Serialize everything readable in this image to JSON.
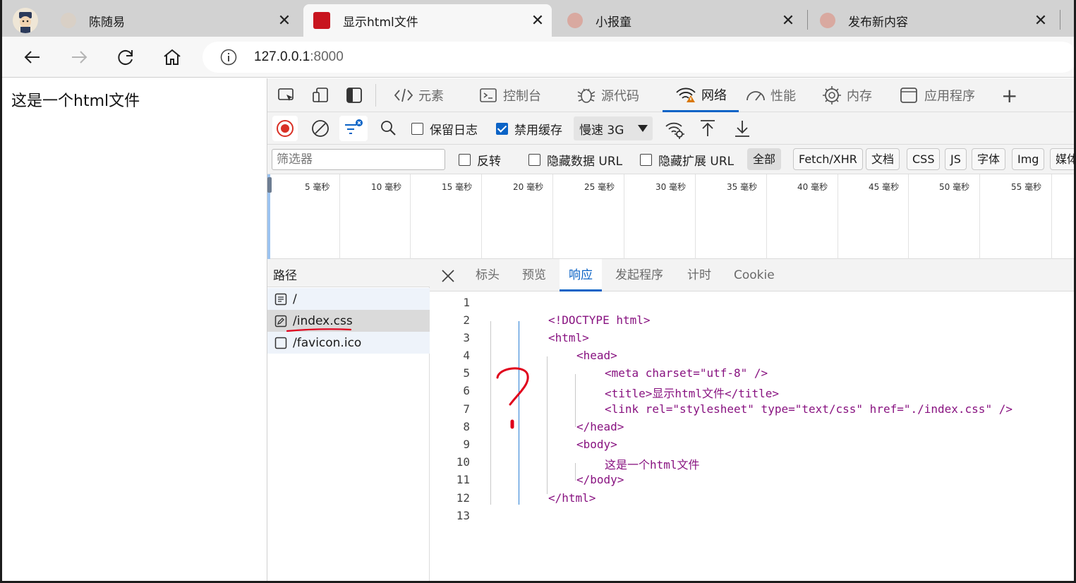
{
  "browser": {
    "tabs": [
      {
        "title": "陈随易",
        "active": false
      },
      {
        "title": "显示html文件",
        "active": true
      },
      {
        "title": "小报童",
        "active": false
      },
      {
        "title": "发布新内容",
        "active": false
      }
    ],
    "close_glyph": "✕",
    "url_host": "127.0.0.1",
    "url_port": ":8000"
  },
  "page": {
    "body_text": "这是一个html文件"
  },
  "devtools": {
    "tabs": [
      {
        "label": "元素",
        "icon": "code-icon"
      },
      {
        "label": "控制台",
        "icon": "console-icon"
      },
      {
        "label": "源代码",
        "icon": "bug-icon"
      },
      {
        "label": "网络",
        "icon": "wifi-warning-icon",
        "active": true
      },
      {
        "label": "性能",
        "icon": "gauge-icon"
      },
      {
        "label": "内存",
        "icon": "cpu-icon"
      },
      {
        "label": "应用程序",
        "icon": "app-window-icon"
      }
    ],
    "add_tab": "+",
    "toolbar": {
      "preserve_log": "保留日志",
      "preserve_log_checked": false,
      "disable_cache": "禁用缓存",
      "disable_cache_checked": true,
      "throttle": "慢速 3G"
    },
    "filter": {
      "placeholder": "筛选器",
      "invert": "反转",
      "hide_data_url": "隐藏数据 URL",
      "hide_ext_url": "隐藏扩展 URL",
      "chips": [
        "全部",
        "Fetch/XHR",
        "文档",
        "CSS",
        "JS",
        "字体",
        "Img",
        "媒体"
      ],
      "selected_chip": "全部"
    },
    "timeline": {
      "ticks": [
        "5 毫秒",
        "10 毫秒",
        "15 毫秒",
        "20 毫秒",
        "25 毫秒",
        "30 毫秒",
        "35 毫秒",
        "40 毫秒",
        "45 毫秒",
        "50 毫秒",
        "55 毫秒"
      ]
    },
    "requests": {
      "header": "路径",
      "items": [
        {
          "name": "/",
          "icon": "document-icon"
        },
        {
          "name": "/index.css",
          "icon": "stylesheet-icon",
          "selected": true
        },
        {
          "name": "/favicon.ico",
          "icon": "image-icon"
        }
      ]
    },
    "detail_tabs": [
      "标头",
      "预览",
      "响应",
      "发起程序",
      "计时",
      "Cookie"
    ],
    "active_detail_tab": "响应",
    "response_lines": [
      "",
      "<!DOCTYPE html>",
      "<html>",
      "<head>",
      "<meta charset=\"utf-8\" />",
      "<title>显示html文件</title>",
      "<link rel=\"stylesheet\" type=\"text/css\" href=\"./index.css\" />",
      "</head>",
      "<body>",
      "这是一个html文件",
      "</body>",
      "</html>",
      ""
    ],
    "line_numbers": [
      "1",
      "2",
      "3",
      "4",
      "5",
      "6",
      "7",
      "8",
      "9",
      "10",
      "11",
      "12",
      "13"
    ]
  },
  "colors": {
    "accent": "#0b63c6",
    "record_red": "#d93025",
    "annotation_red": "#e0001b"
  }
}
